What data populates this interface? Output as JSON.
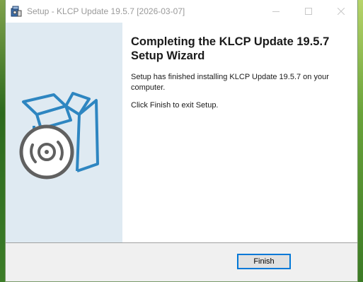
{
  "window": {
    "title": "Setup - KLCP Update 19.5.7 [2026-03-07]",
    "app_icon": "setup-icon",
    "controls": [
      "minimize-icon",
      "maximize-icon",
      "close-icon"
    ]
  },
  "side_panel": {
    "illustration": "software-box-disc-icon",
    "colors": {
      "background": "#dfeaf2",
      "box": "#2e86c1",
      "disc": "#606060"
    }
  },
  "content": {
    "heading": "Completing the KLCP Update 19.5.7 Setup Wizard",
    "message": "Setup has finished installing KLCP Update 19.5.7 on your computer.",
    "instruction": "Click Finish to exit Setup."
  },
  "footer": {
    "finish_label": "Finish"
  },
  "colors": {
    "accent": "#0078d7"
  }
}
